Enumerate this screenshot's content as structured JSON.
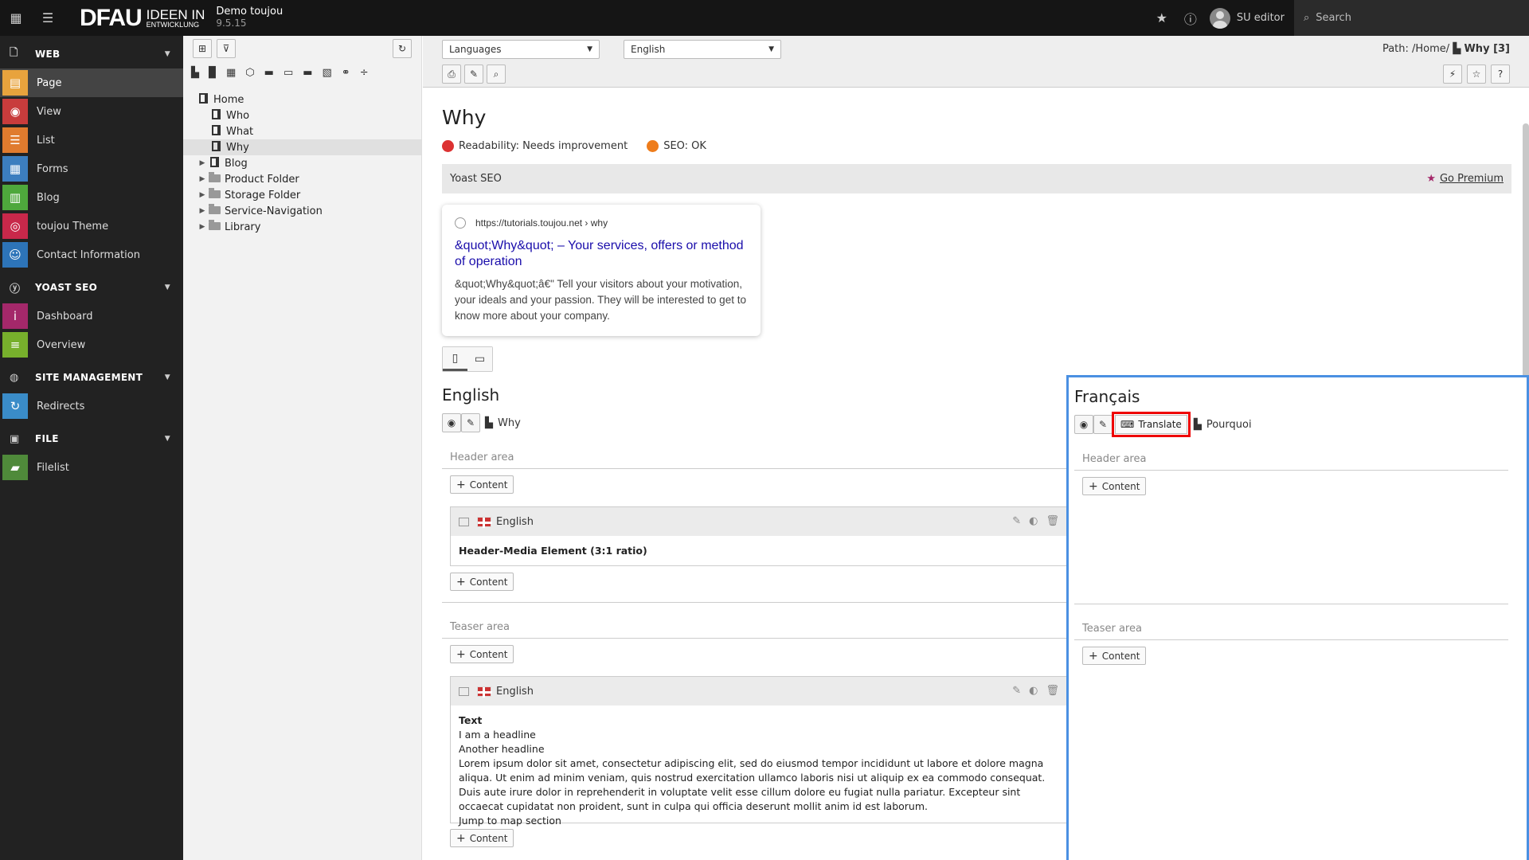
{
  "topbar": {
    "logo_main": "DFAU",
    "logo_line1": "IDEEN IN",
    "logo_line2": "ENTWICKLUNG",
    "site_name": "Demo toujou",
    "site_version": "9.5.15",
    "user_name": "SU editor",
    "search_placeholder": "Search"
  },
  "sidebar": {
    "groups": [
      {
        "label": "WEB"
      },
      {
        "label": "YOAST SEO"
      },
      {
        "label": "SITE MANAGEMENT"
      },
      {
        "label": "FILE"
      }
    ],
    "items": [
      {
        "label": "Page",
        "color": "#e8a33d"
      },
      {
        "label": "View",
        "color": "#c83c3c"
      },
      {
        "label": "List",
        "color": "#e07b2e"
      },
      {
        "label": "Forms",
        "color": "#3c7ebf"
      },
      {
        "label": "Blog",
        "color": "#4ea83c"
      },
      {
        "label": "toujou Theme",
        "color": "#c8284a"
      },
      {
        "label": "Contact Information",
        "color": "#2d74b8"
      },
      {
        "label": "Dashboard",
        "color": "#a4286a"
      },
      {
        "label": "Overview",
        "color": "#77b02c"
      },
      {
        "label": "Redirects",
        "color": "#3a8cc8"
      },
      {
        "label": "Filelist",
        "color": "#4f8a3a"
      }
    ]
  },
  "tree": {
    "nodes": [
      {
        "label": "Home"
      },
      {
        "label": "Who"
      },
      {
        "label": "What"
      },
      {
        "label": "Why"
      },
      {
        "label": "Blog"
      },
      {
        "label": "Product Folder"
      },
      {
        "label": "Storage Folder"
      },
      {
        "label": "Service-Navigation"
      },
      {
        "label": "Library"
      }
    ]
  },
  "docheader": {
    "view_select": "Languages",
    "language_select": "English",
    "path_prefix": "Path: /Home/",
    "path_current": "Why [3]"
  },
  "page": {
    "title": "Why",
    "readability": "Readability: Needs improvement",
    "seo": "SEO: OK",
    "yoast_label": "Yoast SEO",
    "go_premium": "Go Premium",
    "snippet_url": "https://tutorials.toujou.net › why",
    "snippet_title": "&quot;Why&quot; – Your services, offers or method of operation",
    "snippet_desc": "&quot;Why&quot;â€\" Tell your visitors about your motivation, your ideals and your passion. They will be interested to get to know more about your company.",
    "colors": {
      "readability": "#dc3232",
      "seo": "#ee7c1b",
      "accent": "#4a90e2"
    }
  },
  "english": {
    "title": "English",
    "page_name": "Why",
    "header_area": "Header area",
    "teaser_area": "Teaser area",
    "content_btn": "Content",
    "ce1": {
      "lang": "English",
      "text": "Header-Media Element (3:1 ratio)"
    },
    "ce2": {
      "lang": "English",
      "type": "Text",
      "line1": "I am a headline",
      "line2": "Another headline",
      "body": "Lorem ipsum dolor sit amet, consectetur adipiscing elit, sed do eiusmod tempor incididunt ut labore et dolore magna aliqua. Ut enim ad minim veniam, quis nostrud exercitation ullamco laboris nisi ut aliquip ex ea commodo consequat. Duis aute irure dolor in reprehenderit in voluptate velit esse cillum dolore eu fugiat nulla pariatur. Excepteur sint occaecat cupidatat non proident, sunt in culpa qui officia deserunt mollit anim id est laborum.",
      "link": "Jump to map section"
    }
  },
  "french": {
    "title": "Français",
    "translate_btn": "Translate",
    "page_name": "Pourquoi",
    "header_area": "Header area",
    "teaser_area": "Teaser area",
    "content_btn": "Content"
  }
}
